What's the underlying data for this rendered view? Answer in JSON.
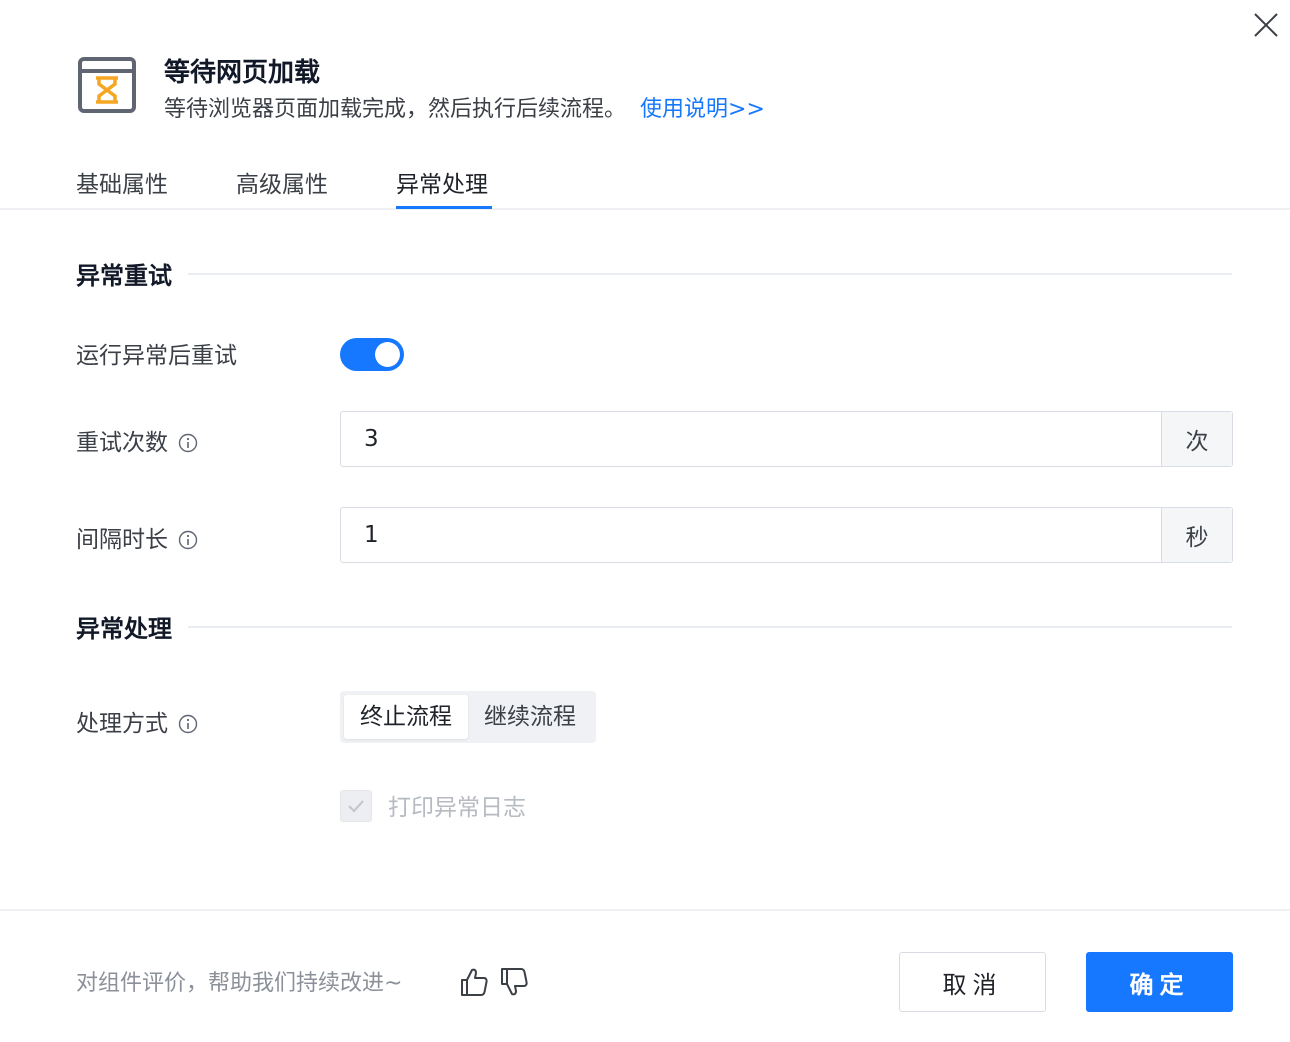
{
  "header": {
    "title": "等待网页加载",
    "description": "等待浏览器页面加载完成，然后执行后续流程。",
    "help_link": "使用说明>>"
  },
  "tabs": [
    {
      "label": "基础属性",
      "active": false
    },
    {
      "label": "高级属性",
      "active": false
    },
    {
      "label": "异常处理",
      "active": true
    }
  ],
  "retry_section": {
    "title": "异常重试",
    "retry_toggle_label": "运行异常后重试",
    "retry_enabled": true,
    "retry_count_label": "重试次数",
    "retry_count_value": "3",
    "retry_count_unit": "次",
    "interval_label": "间隔时长",
    "interval_value": "1",
    "interval_unit": "秒"
  },
  "handling_section": {
    "title": "异常处理",
    "method_label": "处理方式",
    "options": [
      {
        "label": "终止流程",
        "selected": true
      },
      {
        "label": "继续流程",
        "selected": false
      }
    ],
    "print_log_label": "打印异常日志",
    "print_log_checked": true,
    "print_log_disabled": true
  },
  "footer": {
    "feedback_text": "对组件评价，帮助我们持续改进~",
    "cancel_label": "取消",
    "ok_label": "确定"
  },
  "colors": {
    "accent": "#1677ff",
    "icon_orange": "#f5a623",
    "icon_gray": "#5f6672"
  },
  "icons": {
    "component": "hourglass-window-icon",
    "close": "close-icon",
    "info": "info-icon",
    "like": "thumbs-up-icon",
    "dislike": "thumbs-down-icon",
    "check": "check-icon"
  }
}
